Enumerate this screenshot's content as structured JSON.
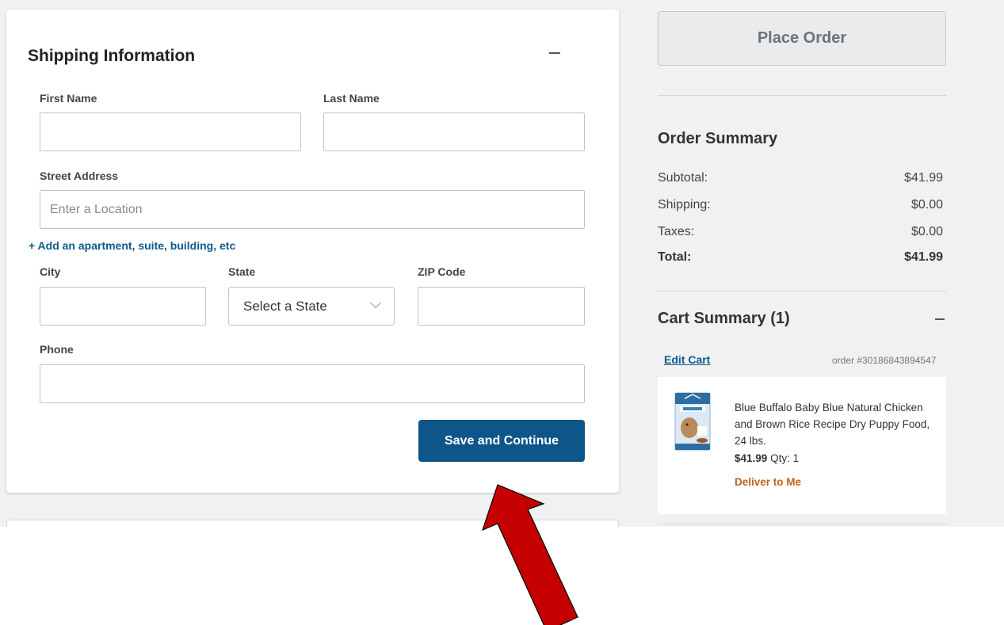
{
  "shipping": {
    "title": "Shipping Information",
    "first_name_label": "First Name",
    "last_name_label": "Last Name",
    "street_label": "Street Address",
    "street_placeholder": "Enter a Location",
    "add_apartment": "+ Add an apartment, suite, building, etc",
    "city_label": "City",
    "state_label": "State",
    "state_value": "Select a State",
    "zip_label": "ZIP Code",
    "phone_label": "Phone",
    "save_button": "Save and Continue"
  },
  "sidebar": {
    "place_order": "Place Order",
    "order_summary": {
      "title": "Order Summary",
      "rows": [
        {
          "label": "Subtotal:",
          "value": "$41.99"
        },
        {
          "label": "Shipping:",
          "value": "$0.00"
        },
        {
          "label": "Taxes:",
          "value": "$0.00"
        },
        {
          "label": "Total:",
          "value": "$41.99"
        }
      ]
    },
    "cart": {
      "title": "Cart Summary (1)",
      "edit_cart": "Edit Cart",
      "order_number": "order #30186843894547",
      "item": {
        "name": "Blue Buffalo Baby Blue Natural Chicken and Brown Rice Recipe Dry Puppy Food, 24 lbs.",
        "price": "$41.99",
        "qty": "Qty: 1",
        "delivery": "Deliver to Me"
      }
    }
  },
  "colors": {
    "primary_button": "#0e5589",
    "link": "#0e5a8a",
    "delivery_text": "#c0621c",
    "annotation_arrow": "#c40000"
  }
}
